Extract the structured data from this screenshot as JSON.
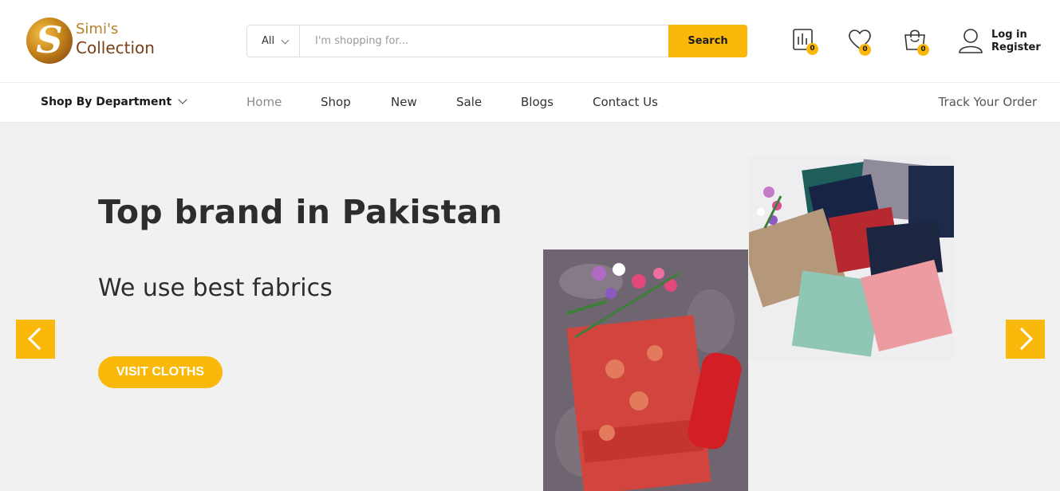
{
  "brand": {
    "logo_letter": "S",
    "name_line1": "Simi's",
    "name_line2": "Collection"
  },
  "search": {
    "category": "All",
    "placeholder": "I'm shopping for...",
    "button_label": "Search"
  },
  "header_icons": [
    {
      "icon": "compare-icon",
      "count": "0"
    },
    {
      "icon": "heart-icon",
      "count": "0"
    },
    {
      "icon": "shopping-bag-icon",
      "count": "0"
    }
  ],
  "account": {
    "icon": "user-icon",
    "login_label": "Log in",
    "register_label": "Register"
  },
  "nav": {
    "department_label": "Shop By Department",
    "items": [
      {
        "label": "Home",
        "active": true
      },
      {
        "label": "Shop"
      },
      {
        "label": "New"
      },
      {
        "label": "Sale"
      },
      {
        "label": "Blogs"
      },
      {
        "label": "Contact Us"
      }
    ],
    "track_label": "Track Your Order"
  },
  "hero": {
    "title": "Top brand in Pakistan",
    "subtitle": "We use best fabrics",
    "cta_label": "VISIT CLOTHS",
    "prev_icon": "chevron-left-icon",
    "next_icon": "chevron-right-icon"
  },
  "colors": {
    "accent": "#fab80a",
    "hero_bg": "#f1f1f1",
    "text_dark": "#2d2d2d"
  }
}
